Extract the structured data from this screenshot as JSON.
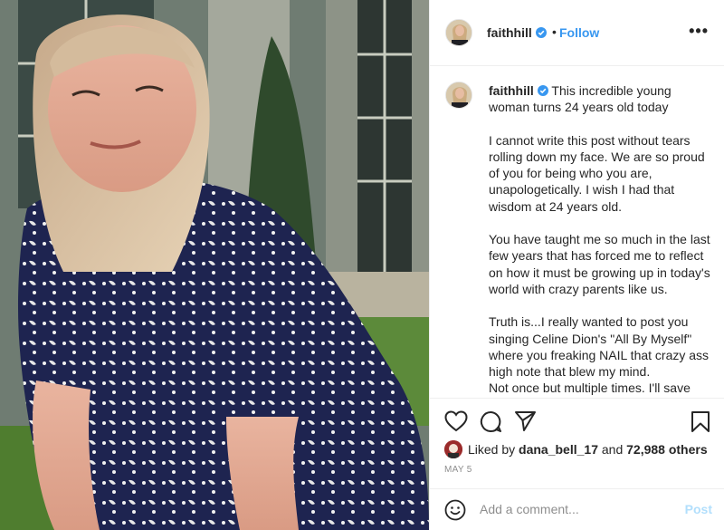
{
  "post": {
    "username": "faithhill",
    "follow_label": "Follow",
    "separator": "•",
    "more_label": "•••",
    "caption_first": "This incredible young woman turns 24 years old today",
    "caption_paragraphs": [
      "I cannot write this post without tears rolling down my face. We are so proud of you for being who you are, unapologetically. I wish I had that wisdom at 24 years old.",
      "You have taught me so much in the last few years that has forced me to reflect on how it must be growing up in today's world with crazy parents like us.",
      "Truth is...I really wanted to post you singing Celine Dion's \"All By Myself\" where you freaking NAIL that crazy ass high note that blew my mind.\nNot once but multiple times. I'll save that for another time😘 😘"
    ],
    "likes_prefix": "Liked by ",
    "liked_by_user": "dana_bell_17",
    "likes_and": " and ",
    "likes_count": "72,988 others",
    "date": "MAY 5",
    "comment_placeholder": "Add a comment...",
    "post_label": "Post"
  },
  "icons": {
    "verified": "verified-badge-icon",
    "like": "heart-icon",
    "comment": "comment-bubble-icon",
    "share": "paper-plane-icon",
    "save": "bookmark-icon",
    "emoji": "smiley-icon"
  },
  "colors": {
    "link_blue": "#3897f0",
    "post_disabled": "#b2dffc",
    "muted": "#8e8e8e",
    "text": "#262626"
  }
}
